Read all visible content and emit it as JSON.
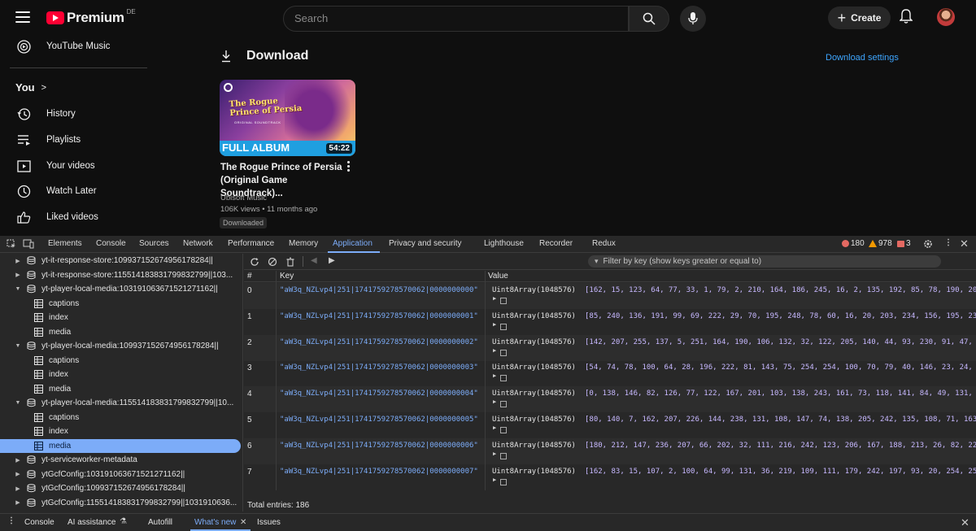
{
  "yt": {
    "logo_text": "Premium",
    "logo_region": "DE",
    "search_placeholder": "Search",
    "create_label": "Create",
    "sidebar_top": "YouTube Music",
    "you_label": "You",
    "sidebar_items": [
      "History",
      "Playlists",
      "Your videos",
      "Watch Later",
      "Liked videos"
    ],
    "page_title": "Download",
    "settings_link": "Download settings",
    "video": {
      "thumb_title": "The Rogue Prince of Persia",
      "thumb_subtitle": "ORIGINAL SOUNDTRACK",
      "thumb_banner": "FULL ALBUM",
      "duration": "54:22",
      "title": "The Rogue Prince of Persia (Original Game Soundtrack)...",
      "channel": "Ubisoft Music",
      "meta": "106K views • 11 months ago",
      "badge": "Downloaded"
    }
  },
  "devtools": {
    "tabs": [
      "Elements",
      "Console",
      "Sources",
      "Network",
      "Performance",
      "Memory",
      "Application",
      "Privacy and security",
      "Lighthouse",
      "Recorder",
      "Redux"
    ],
    "active_tab": "Application",
    "errors": "180",
    "warnings": "978",
    "issues": "3",
    "tree": [
      {
        "type": "db",
        "label": "yt-it-response-store:109937152674956178284||",
        "expanded": false
      },
      {
        "type": "db",
        "label": "yt-it-response-store:115514183831799832799||103...",
        "expanded": false
      },
      {
        "type": "db",
        "label": "yt-player-local-media:103191063671521271162||",
        "expanded": true
      },
      {
        "type": "table",
        "label": "captions"
      },
      {
        "type": "table",
        "label": "index"
      },
      {
        "type": "table",
        "label": "media"
      },
      {
        "type": "db",
        "label": "yt-player-local-media:109937152674956178284||",
        "expanded": true
      },
      {
        "type": "table",
        "label": "captions"
      },
      {
        "type": "table",
        "label": "index"
      },
      {
        "type": "table",
        "label": "media"
      },
      {
        "type": "db",
        "label": "yt-player-local-media:115514183831799832799||10...",
        "expanded": true
      },
      {
        "type": "table",
        "label": "captions"
      },
      {
        "type": "table",
        "label": "index"
      },
      {
        "type": "table",
        "label": "media",
        "selected": true
      },
      {
        "type": "db",
        "label": "yt-serviceworker-metadata",
        "expanded": false
      },
      {
        "type": "db",
        "label": "ytGcfConfig:103191063671521271162||",
        "expanded": false
      },
      {
        "type": "db",
        "label": "ytGcfConfig:109937152674956178284||",
        "expanded": false
      },
      {
        "type": "db",
        "label": "ytGcfConfig:115514183831799832799||1031910636...",
        "expanded": false
      }
    ],
    "filter_placeholder": "Filter by key (show keys greater or equal to)",
    "columns": [
      "#",
      "Key",
      "Value"
    ],
    "rows": [
      {
        "idx": "0",
        "key": "\"aW3q_NZLvp4|251|1741759278570062|0000000000\"",
        "type": "Uint8Array(1048576)",
        "data": "[162, 15, 123, 64, 77, 33, 1, 79, 2, 210, 164, 186, 245, 16, 2, 135, 192, 85, 78, 190, 20"
      },
      {
        "idx": "1",
        "key": "\"aW3q_NZLvp4|251|1741759278570062|0000000001\"",
        "type": "Uint8Array(1048576)",
        "data": "[85, 240, 136, 191, 99, 69, 222, 29, 70, 195, 248, 78, 60, 16, 20, 203, 234, 156, 195, 23"
      },
      {
        "idx": "2",
        "key": "\"aW3q_NZLvp4|251|1741759278570062|0000000002\"",
        "type": "Uint8Array(1048576)",
        "data": "[142, 207, 255, 137, 5, 251, 164, 190, 106, 132, 32, 122, 205, 140, 44, 93, 230, 91, 47,"
      },
      {
        "idx": "3",
        "key": "\"aW3q_NZLvp4|251|1741759278570062|0000000003\"",
        "type": "Uint8Array(1048576)",
        "data": "[54, 74, 78, 100, 64, 28, 196, 222, 81, 143, 75, 254, 254, 100, 70, 79, 40, 146, 23, 24,"
      },
      {
        "idx": "4",
        "key": "\"aW3q_NZLvp4|251|1741759278570062|0000000004\"",
        "type": "Uint8Array(1048576)",
        "data": "[0, 138, 146, 82, 126, 77, 122, 167, 201, 103, 138, 243, 161, 73, 118, 141, 84, 49, 131,"
      },
      {
        "idx": "5",
        "key": "\"aW3q_NZLvp4|251|1741759278570062|0000000005\"",
        "type": "Uint8Array(1048576)",
        "data": "[80, 140, 7, 162, 207, 226, 144, 238, 131, 108, 147, 74, 138, 205, 242, 135, 108, 71, 163"
      },
      {
        "idx": "6",
        "key": "\"aW3q_NZLvp4|251|1741759278570062|0000000006\"",
        "type": "Uint8Array(1048576)",
        "data": "[180, 212, 147, 236, 207, 66, 202, 32, 111, 216, 242, 123, 206, 167, 188, 213, 26, 82, 22"
      },
      {
        "idx": "7",
        "key": "\"aW3q_NZLvp4|251|1741759278570062|0000000007\"",
        "type": "Uint8Array(1048576)",
        "data": "[162, 83, 15, 107, 2, 100, 64, 99, 131, 36, 219, 109, 111, 179, 242, 197, 93, 20, 254, 25"
      }
    ],
    "total": "Total entries: 186",
    "bottom_tabs": [
      "Console",
      "AI assistance",
      "Autofill",
      "What's new",
      "Issues"
    ],
    "bottom_active": "What's new"
  }
}
